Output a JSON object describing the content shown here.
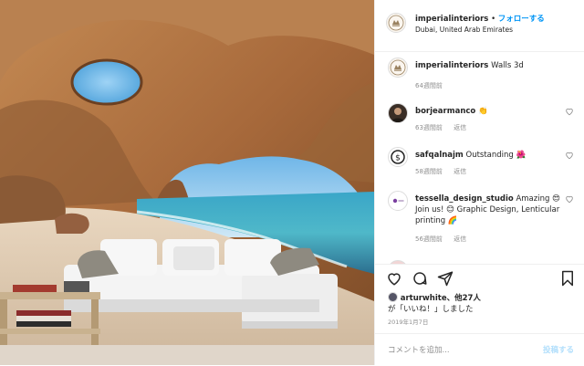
{
  "header": {
    "username": "imperialinteriors",
    "separator": "•",
    "follow_label": "フォローする",
    "location": "Dubai, United Arab Emirates"
  },
  "caption": {
    "username": "imperialinteriors",
    "text": "Walls 3d",
    "time": "64週間前"
  },
  "comments": [
    {
      "username": "borjearmanco",
      "text": "👏",
      "time": "63週間前",
      "reply": "返信"
    },
    {
      "username": "safqalnajm",
      "text": "Outstanding 🌺",
      "time": "58週間前",
      "reply": "返信"
    },
    {
      "username": "tessella_design_studio",
      "text": "Amazing 😍 Join us! 😊 Graphic Design, Lenticular printing 🌈",
      "time": "56週間前",
      "reply": "返信"
    }
  ],
  "likes": {
    "user": "arturwhite",
    "others": "、他27人",
    "suffix": "が「いいね！」しました"
  },
  "date": "2019年1月7日",
  "add_comment": {
    "placeholder": "コメントを追加...",
    "post_label": "投稿する"
  },
  "icons": [
    "heart-icon",
    "comment-icon",
    "share-icon",
    "bookmark-icon"
  ],
  "colors": {
    "link": "#0095f6",
    "muted": "#8e8e8e",
    "post_disabled": "#b2dffc"
  }
}
